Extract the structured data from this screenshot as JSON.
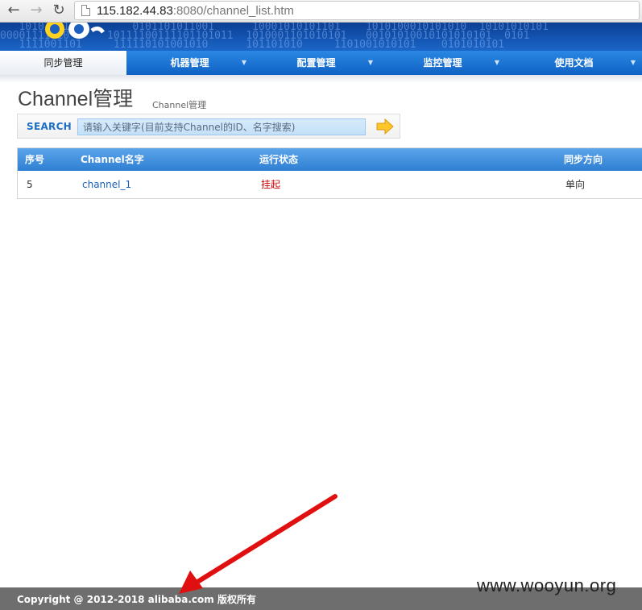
{
  "browser": {
    "url_host": "115.182.44.83",
    "url_rest": ":8080/channel_list.htm",
    "icons": [
      "back-arrow-icon",
      "forward-arrow-icon",
      "reload-icon",
      "page-icon"
    ]
  },
  "menu": {
    "items": [
      {
        "label": "同步管理",
        "active": true
      },
      {
        "label": "机器管理"
      },
      {
        "label": "配置管理"
      },
      {
        "label": "监控管理"
      },
      {
        "label": "使用文档"
      }
    ]
  },
  "page": {
    "title": "Channel管理",
    "breadcrumb": "Channel管理"
  },
  "search": {
    "label": "SEARCH",
    "placeholder": "请输入关键字(目前支持Channel的ID、名字搜索)"
  },
  "table": {
    "headers": [
      "序号",
      "Channel名字",
      "运行状态",
      "同步方向"
    ],
    "rows": [
      {
        "id": "5",
        "name": "channel_1",
        "status": "挂起",
        "direction": "单向"
      }
    ]
  },
  "footer": {
    "copyright": "Copyright @ 2012-2018  alibaba.com  版权所有"
  },
  "watermark": "www.wooyun.org",
  "colors": {
    "menu_blue": "#1a73d6",
    "status_red": "#d40000",
    "arrow_red": "#e01010",
    "footer_gray": "#6e6e6e"
  }
}
